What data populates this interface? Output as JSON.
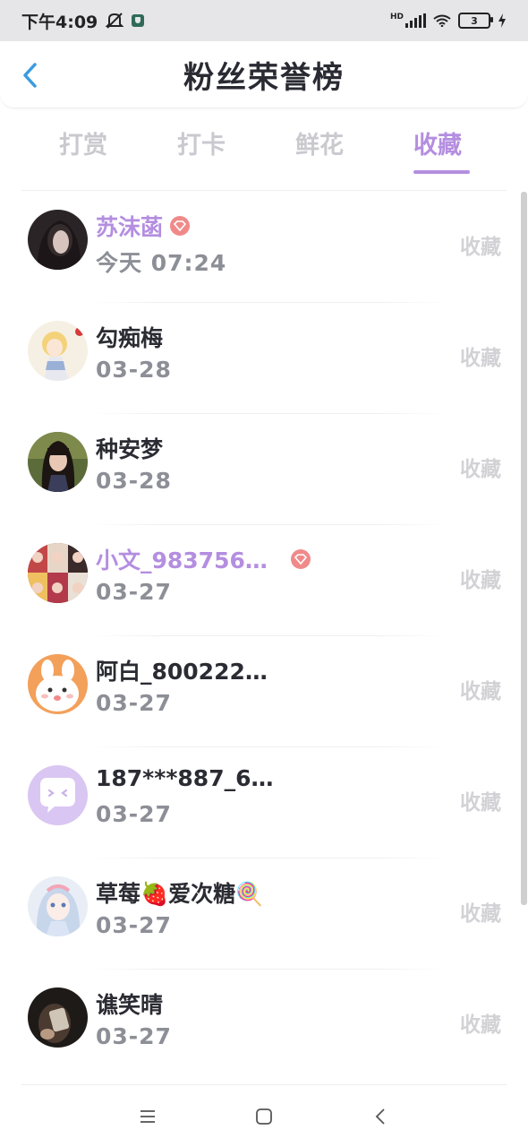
{
  "status_bar": {
    "time": "下午4:09",
    "network": "HD",
    "battery": "3"
  },
  "header": {
    "title": "粉丝荣誉榜",
    "back_icon": "chevron-left-icon"
  },
  "colors": {
    "accent": "#b48ee0",
    "vip_badge": "#f08a8a",
    "muted": "#d2d2d6",
    "time": "#8d8f97"
  },
  "tabs": [
    {
      "label": "打赏",
      "active": false
    },
    {
      "label": "打卡",
      "active": false
    },
    {
      "label": "鲜花",
      "active": false
    },
    {
      "label": "收藏",
      "active": true
    }
  ],
  "fans": [
    {
      "name": "苏沫菡",
      "time": "今天 07:24",
      "action": "收藏",
      "vip": true,
      "avatar": "dark-portrait"
    },
    {
      "name": "勾痴梅",
      "time": "03-28",
      "action": "收藏",
      "vip": false,
      "avatar": "anime-girl-blonde"
    },
    {
      "name": "种安梦",
      "time": "03-28",
      "action": "收藏",
      "vip": false,
      "avatar": "girl-bangs"
    },
    {
      "name": "小文_983756…",
      "time": "03-27",
      "action": "收藏",
      "vip": true,
      "avatar": "group-collage"
    },
    {
      "name": "阿白_800222…",
      "time": "03-27",
      "action": "收藏",
      "vip": false,
      "avatar": "white-bunny"
    },
    {
      "name": "187***887_6…",
      "time": "03-27",
      "action": "收藏",
      "vip": false,
      "avatar": "default-chat"
    },
    {
      "name": "草莓🍓爱次糖🍭",
      "time": "03-27",
      "action": "收藏",
      "vip": false,
      "avatar": "anime-girl-blue"
    },
    {
      "name": "谯笑晴",
      "time": "03-27",
      "action": "收藏",
      "vip": false,
      "avatar": "dark-selfie"
    }
  ],
  "nav_bar": {
    "menu_icon": "menu-icon",
    "home_icon": "home-square-icon",
    "back_icon": "back-triangle-icon"
  }
}
